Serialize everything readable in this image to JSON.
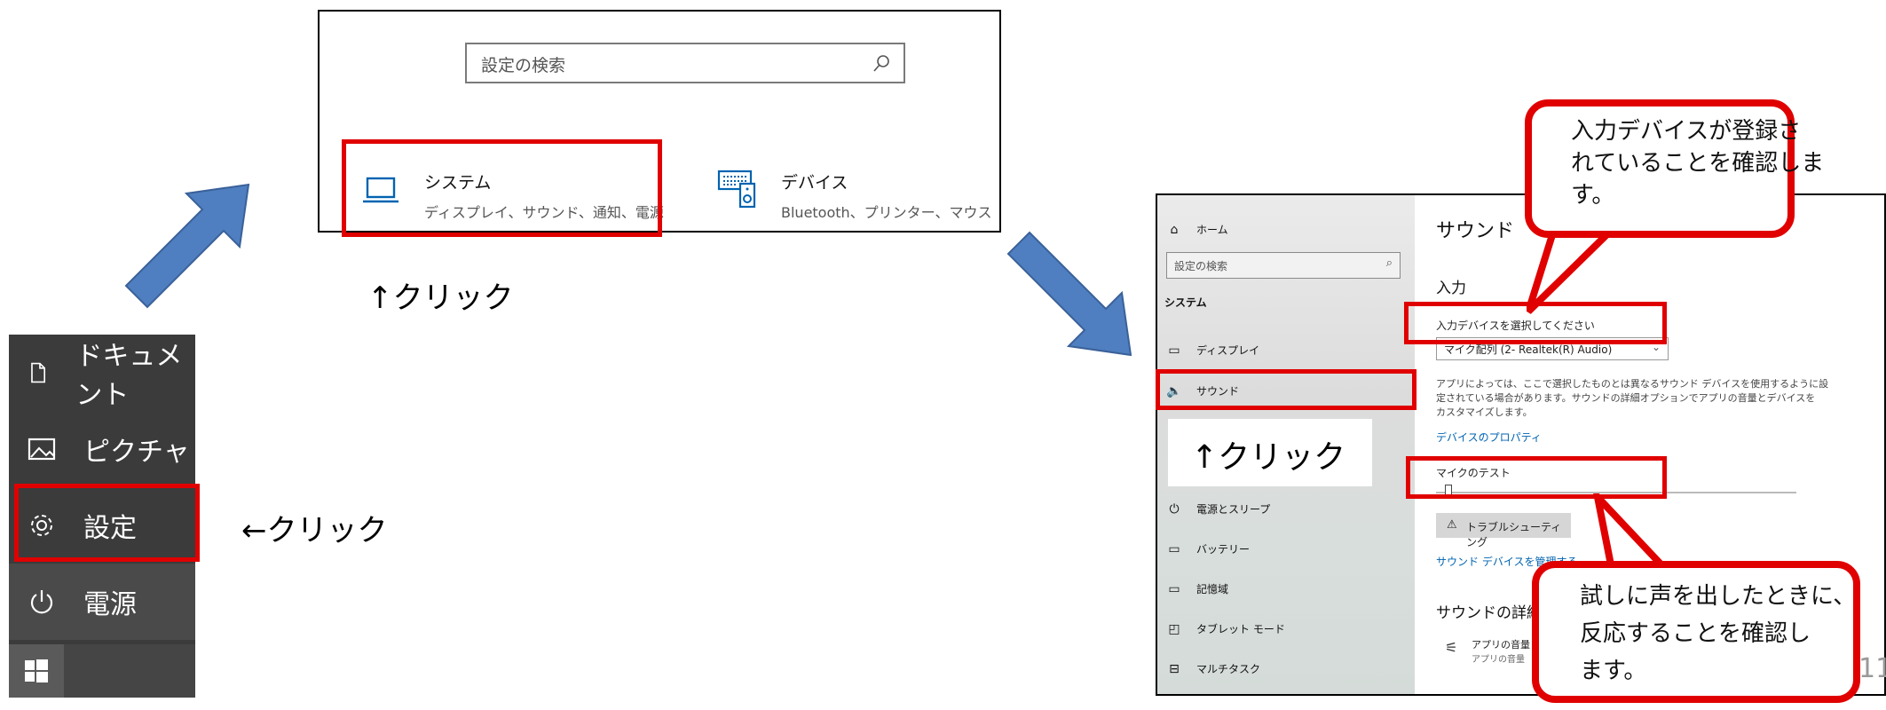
{
  "start_menu": {
    "items": [
      {
        "label": "ドキュメント",
        "icon": "document-icon"
      },
      {
        "label": "ピクチャ",
        "icon": "picture-icon"
      },
      {
        "label": "設定",
        "icon": "gear-icon"
      },
      {
        "label": "電源",
        "icon": "power-icon"
      }
    ],
    "windows_icon": "windows-logo-icon"
  },
  "top_window": {
    "search_placeholder": "設定の検索",
    "tiles": [
      {
        "title": "システム",
        "subtitle": "ディスプレイ、サウンド、通知、電源",
        "icon": "laptop-icon"
      },
      {
        "title": "デバイス",
        "subtitle": "Bluetooth、プリンター、マウス",
        "icon": "keyboard-speaker-icon"
      }
    ]
  },
  "annotations": {
    "click_up_top": "↑クリック",
    "click_left": "←クリック",
    "click_up_sound": "↑クリック"
  },
  "sound_window": {
    "home": "ホーム",
    "search_placeholder": "設定の検索",
    "section": "システム",
    "sidebar": [
      {
        "label": "ディスプレイ",
        "icon": "monitor-icon"
      },
      {
        "label": "サウンド",
        "icon": "speaker-icon"
      },
      {
        "label": "電源とスリープ",
        "icon": "power-icon"
      },
      {
        "label": "バッテリー",
        "icon": "battery-icon"
      },
      {
        "label": "記憶域",
        "icon": "storage-icon"
      },
      {
        "label": "タブレット モード",
        "icon": "tablet-icon"
      },
      {
        "label": "マルチタスク",
        "icon": "multitask-icon"
      }
    ],
    "page_title": "サウンド",
    "input_heading": "入力",
    "select_device_label": "入力デバイスを選択してください",
    "selected_device": "マイク配列 (2- Realtek(R) Audio)",
    "description_lines": [
      "アプリによっては、ここで選択したものとは異なるサウンド デバイスを使用するように設",
      "定されている場合があります。サウンドの詳細オプションでアプリの音量とデバイスを",
      "カスタマイズします。"
    ],
    "device_properties_link": "デバイスのプロパティ",
    "mic_test_label": "マイクのテスト",
    "troubleshoot_button": "トラブルシューティング",
    "manage_devices_link": "サウンド デバイスを管理する",
    "advanced_heading": "サウンドの詳細",
    "app_volume_title": "アプリの音量",
    "app_volume_sub": "アプリの音量"
  },
  "callouts": {
    "top_lines": [
      "入力デバイスが登録さ",
      "れていることを確認しま",
      "す。"
    ],
    "bottom_lines": [
      "試しに声を出したときに、",
      "反応することを確認し",
      "ます。"
    ]
  },
  "page_number": "11",
  "colors": {
    "highlight_red": "#e00000",
    "arrow_blue": "#4f7fc0",
    "link_blue": "#0063b1"
  }
}
